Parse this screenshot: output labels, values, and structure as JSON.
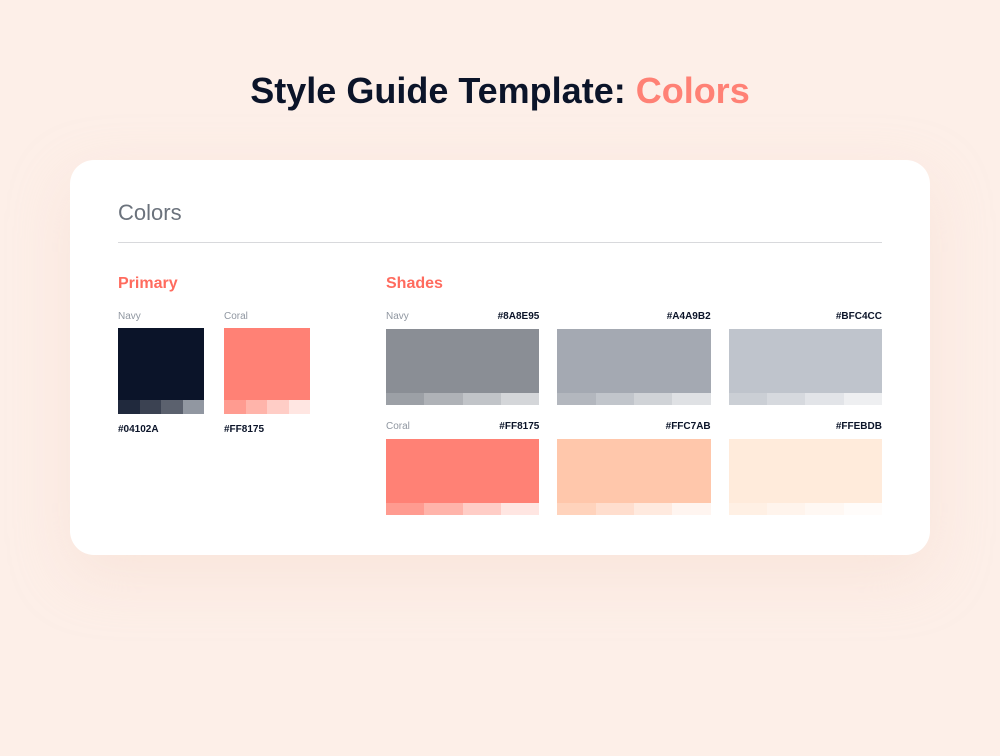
{
  "title": {
    "prefix": "Style Guide Template: ",
    "accent": "Colors"
  },
  "card": {
    "header": "Colors"
  },
  "primary": {
    "title": "Primary",
    "items": [
      {
        "name": "Navy",
        "hex": "#04102A",
        "main": "#0B1429",
        "band": [
          "#20293D",
          "#3B4252",
          "#5B616E",
          "#9197A1"
        ]
      },
      {
        "name": "Coral",
        "hex": "#FF8175",
        "main": "#FF8175",
        "band": [
          "#FF9B90",
          "#FFB4AA",
          "#FFCDC6",
          "#FFE6E2"
        ]
      }
    ]
  },
  "shades": {
    "title": "Shades",
    "rows": [
      [
        {
          "name": "Navy",
          "hex": "#8A8E95",
          "main": "#8A8E95",
          "band": [
            "#9CA0A6",
            "#AFB2B7",
            "#C1C4C8",
            "#D4D6D9"
          ]
        },
        {
          "name": "",
          "hex": "#A4A9B2",
          "main": "#A4A9B2",
          "band": [
            "#B3B7BE",
            "#C1C5CB",
            "#D0D3D7",
            "#DFE1E4"
          ]
        },
        {
          "name": "",
          "hex": "#BFC4CC",
          "main": "#BFC4CC",
          "band": [
            "#CBCFD5",
            "#D6D9DE",
            "#E2E4E8",
            "#EEEFF1"
          ]
        }
      ],
      [
        {
          "name": "Coral",
          "hex": "#FF8175",
          "main": "#FF8175",
          "band": [
            "#FF9B90",
            "#FFB4AA",
            "#FFCDC6",
            "#FFE6E2"
          ]
        },
        {
          "name": "",
          "hex": "#FFC7AB",
          "main": "#FFC7AB",
          "band": [
            "#FFD3BC",
            "#FFDECE",
            "#FFEADF",
            "#FFF5F0"
          ]
        },
        {
          "name": "",
          "hex": "#FFEBDB",
          "main": "#FFEBDB",
          "band": [
            "#FFF0E4",
            "#FFF4EC",
            "#FFF8F3",
            "#FFFCFA"
          ]
        }
      ]
    ]
  }
}
